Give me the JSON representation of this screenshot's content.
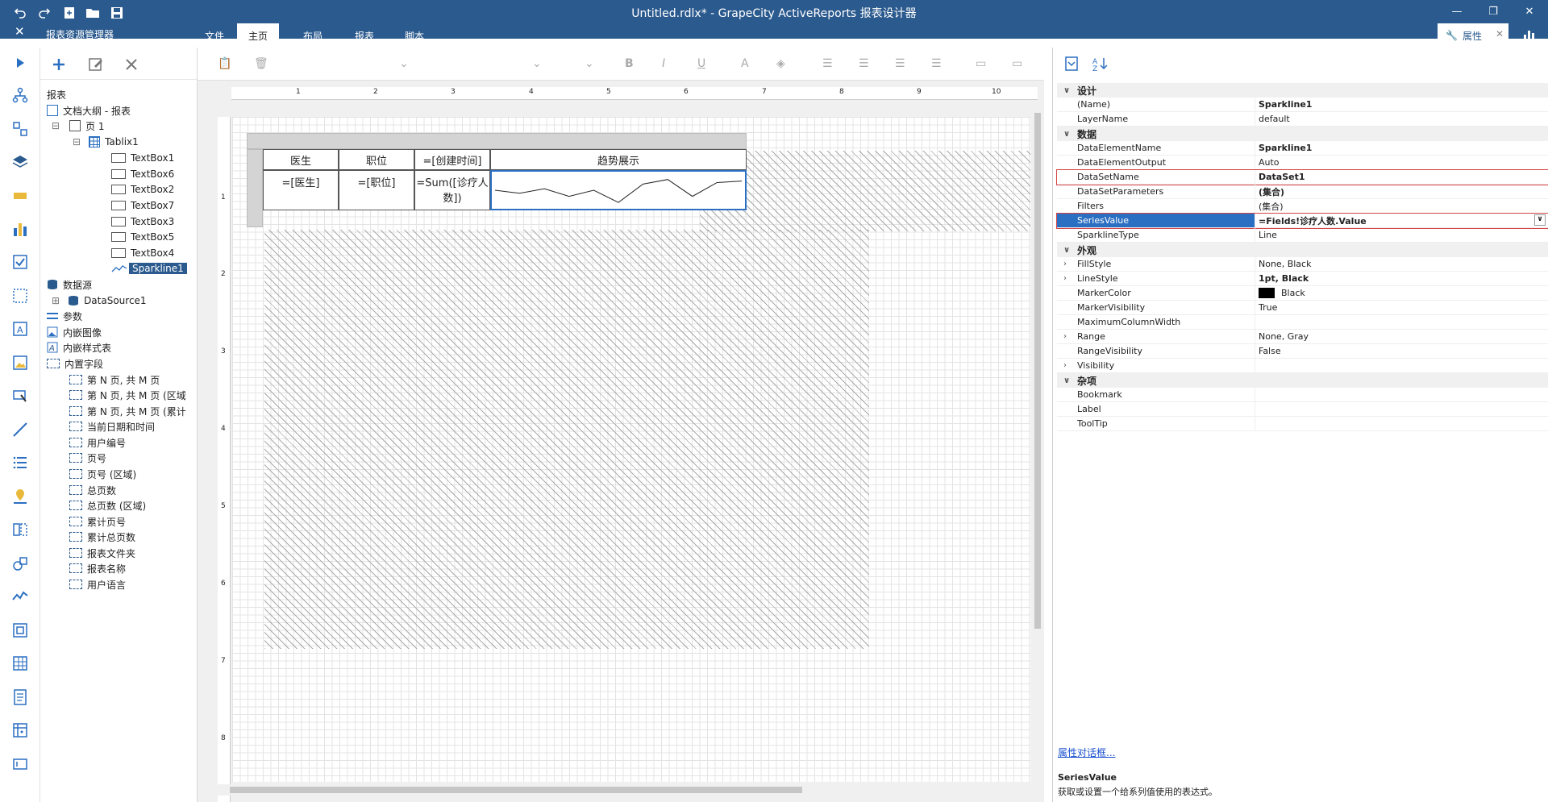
{
  "window": {
    "title": "Untitled.rdlx* - GrapeCity ActiveReports 报表设计器"
  },
  "explorer": {
    "title": "报表资源管理器",
    "root": "报表"
  },
  "tabs": [
    "文件",
    "主页",
    "布局",
    "报表",
    "脚本"
  ],
  "properties_tab": "属性",
  "tree": {
    "doc_outline": "文档大纲 - 报表",
    "page": "页 1",
    "tablix": "Tablix1",
    "items": [
      "TextBox1",
      "TextBox6",
      "TextBox2",
      "TextBox7",
      "TextBox3",
      "TextBox5",
      "TextBox4"
    ],
    "selected": "Sparkline1",
    "datasource_group": "数据源",
    "datasource": "DataSource1",
    "params": "参数",
    "images": "内嵌图像",
    "styles": "内嵌样式表",
    "fields_group": "内置字段",
    "fields": [
      "第 N 页, 共 M 页",
      "第 N 页, 共 M 页 (区域",
      "第 N 页, 共 M 页 (累计",
      "当前日期和时间",
      "用户编号",
      "页号",
      "页号 (区域)",
      "总页数",
      "总页数 (区域)",
      "累计页号",
      "累计总页数",
      "报表文件夹",
      "报表名称",
      "用户语言"
    ]
  },
  "table": {
    "headers": [
      "医生",
      "职位",
      "=[创建时间]",
      "趋势展示"
    ],
    "cells": [
      "=[医生]",
      "=[职位]",
      "=Sum([诊疗人数])"
    ]
  },
  "ruler_numbers": [
    "1",
    "2",
    "3",
    "4",
    "5",
    "6",
    "7",
    "8",
    "9",
    "10"
  ],
  "ruler_v_numbers": [
    "1",
    "2",
    "3",
    "4",
    "5",
    "6",
    "7",
    "8"
  ],
  "sparkline_values": [
    0.5,
    0.4,
    0.55,
    0.3,
    0.5,
    0.1,
    0.7,
    0.85,
    0.3,
    0.75,
    0.8
  ],
  "properties": {
    "cat_design": "设计",
    "cat_data": "数据",
    "cat_appearance": "外观",
    "cat_misc": "杂项",
    "design": [
      [
        "(Name)",
        "Sparkline1"
      ],
      [
        "LayerName",
        "default"
      ]
    ],
    "data": [
      [
        "DataElementName",
        "Sparkline1"
      ],
      [
        "DataElementOutput",
        "Auto"
      ],
      [
        "DataSetName",
        "DataSet1"
      ],
      [
        "DataSetParameters",
        "(集合)"
      ],
      [
        "Filters",
        "(集合)"
      ],
      [
        "SeriesValue",
        "=Fields!诊疗人数.Value"
      ],
      [
        "SparklineType",
        "Line"
      ]
    ],
    "appearance": [
      [
        "FillStyle",
        "None, Black"
      ],
      [
        "LineStyle",
        "1pt, Black"
      ],
      [
        "MarkerColor",
        "Black"
      ],
      [
        "MarkerVisibility",
        "True"
      ],
      [
        "MaximumColumnWidth",
        ""
      ],
      [
        "Range",
        "None, Gray"
      ],
      [
        "RangeVisibility",
        "False"
      ],
      [
        "Visibility",
        ""
      ]
    ],
    "misc": [
      [
        "Bookmark",
        ""
      ],
      [
        "Label",
        ""
      ],
      [
        "ToolTip",
        ""
      ]
    ],
    "link": "属性对话框...",
    "desc_title": "SeriesValue",
    "desc_text": "获取或设置一个给系列值使用的表达式。"
  }
}
